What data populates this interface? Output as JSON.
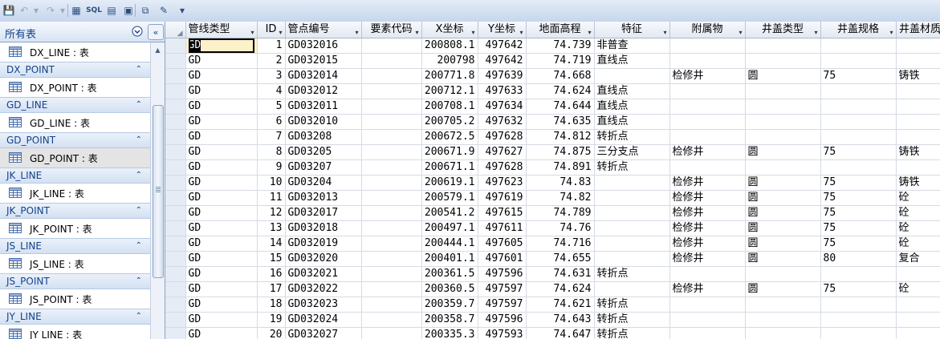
{
  "toolbar": {
    "buttons": [
      {
        "name": "save-icon",
        "glyph": "💾"
      },
      {
        "name": "undo-icon",
        "glyph": "↶"
      },
      {
        "name": "undo-dropdown-icon",
        "glyph": "▾"
      },
      {
        "name": "redo-icon",
        "glyph": "↷"
      },
      {
        "name": "redo-dropdown-icon",
        "glyph": "▾"
      },
      {
        "name": "form-wizard-icon",
        "glyph": "▦"
      },
      {
        "name": "sql-icon",
        "glyph": "SQL"
      },
      {
        "name": "report-icon",
        "glyph": "▤"
      },
      {
        "name": "query-icon",
        "glyph": "▣"
      },
      {
        "name": "toggle-view-icon",
        "glyph": "⧉"
      },
      {
        "name": "tools-icon",
        "glyph": "✎"
      },
      {
        "name": "customize-dropdown-icon",
        "glyph": "▾"
      }
    ]
  },
  "nav": {
    "title": "所有表",
    "menu_glyph": "⊙",
    "collapse_glyph": "«",
    "groups": [
      {
        "title": null,
        "items": [
          "DX_LINE : 表"
        ]
      },
      {
        "title": "DX_POINT",
        "items": [
          "DX_POINT : 表"
        ]
      },
      {
        "title": "GD_LINE",
        "items": [
          "GD_LINE : 表"
        ]
      },
      {
        "title": "GD_POINT",
        "items": [
          "GD_POINT : 表"
        ],
        "selected": true
      },
      {
        "title": "JK_LINE",
        "items": [
          "JK_LINE : 表"
        ]
      },
      {
        "title": "JK_POINT",
        "items": [
          "JK_POINT : 表"
        ]
      },
      {
        "title": "JS_LINE",
        "items": [
          "JS_LINE : 表"
        ]
      },
      {
        "title": "JS_POINT",
        "items": [
          "JS_POINT : 表"
        ]
      },
      {
        "title": "JY_LINE",
        "items": [
          "JY LINE : 表"
        ]
      }
    ],
    "chevron_glyph": "⌃"
  },
  "datasheet": {
    "columns": [
      "管线类型",
      "ID",
      "管点编号",
      "要素代码",
      "X坐标",
      "Y坐标",
      "地面高程",
      "特征",
      "附属物",
      "井盖类型",
      "井盖规格",
      "井盖材质"
    ],
    "rows": [
      [
        "GD",
        "1",
        "GD032016",
        "",
        "200808.1",
        "497642",
        "74.739",
        "非普查",
        "",
        "",
        "",
        ""
      ],
      [
        "GD",
        "2",
        "GD032015",
        "",
        "200798",
        "497642",
        "74.719",
        "直线点",
        "",
        "",
        "",
        ""
      ],
      [
        "GD",
        "3",
        "GD032014",
        "",
        "200771.8",
        "497639",
        "74.668",
        "",
        "检修井",
        "圆",
        "75",
        "铸铁"
      ],
      [
        "GD",
        "4",
        "GD032012",
        "",
        "200712.1",
        "497633",
        "74.624",
        "直线点",
        "",
        "",
        "",
        ""
      ],
      [
        "GD",
        "5",
        "GD032011",
        "",
        "200708.1",
        "497634",
        "74.644",
        "直线点",
        "",
        "",
        "",
        ""
      ],
      [
        "GD",
        "6",
        "GD032010",
        "",
        "200705.2",
        "497632",
        "74.635",
        "直线点",
        "",
        "",
        "",
        ""
      ],
      [
        "GD",
        "7",
        "GD03208",
        "",
        "200672.5",
        "497628",
        "74.812",
        "转折点",
        "",
        "",
        "",
        ""
      ],
      [
        "GD",
        "8",
        "GD03205",
        "",
        "200671.9",
        "497627",
        "74.875",
        "三分支点",
        "检修井",
        "圆",
        "75",
        "铸铁"
      ],
      [
        "GD",
        "9",
        "GD03207",
        "",
        "200671.1",
        "497628",
        "74.891",
        "转折点",
        "",
        "",
        "",
        ""
      ],
      [
        "GD",
        "10",
        "GD03204",
        "",
        "200619.1",
        "497623",
        "74.83",
        "",
        "检修井",
        "圆",
        "75",
        "铸铁"
      ],
      [
        "GD",
        "11",
        "GD032013",
        "",
        "200579.1",
        "497619",
        "74.82",
        "",
        "检修井",
        "圆",
        "75",
        "砼"
      ],
      [
        "GD",
        "12",
        "GD032017",
        "",
        "200541.2",
        "497615",
        "74.789",
        "",
        "检修井",
        "圆",
        "75",
        "砼"
      ],
      [
        "GD",
        "13",
        "GD032018",
        "",
        "200497.1",
        "497611",
        "74.76",
        "",
        "检修井",
        "圆",
        "75",
        "砼"
      ],
      [
        "GD",
        "14",
        "GD032019",
        "",
        "200444.1",
        "497605",
        "74.716",
        "",
        "检修井",
        "圆",
        "75",
        "砼"
      ],
      [
        "GD",
        "15",
        "GD032020",
        "",
        "200401.1",
        "497601",
        "74.655",
        "",
        "检修井",
        "圆",
        "80",
        "复合"
      ],
      [
        "GD",
        "16",
        "GD032021",
        "",
        "200361.5",
        "497596",
        "74.631",
        "转折点",
        "",
        "",
        "",
        ""
      ],
      [
        "GD",
        "17",
        "GD032022",
        "",
        "200360.5",
        "497597",
        "74.624",
        "",
        "检修井",
        "圆",
        "75",
        "砼"
      ],
      [
        "GD",
        "18",
        "GD032023",
        "",
        "200359.7",
        "497597",
        "74.621",
        "转折点",
        "",
        "",
        "",
        ""
      ],
      [
        "GD",
        "19",
        "GD032024",
        "",
        "200358.7",
        "497596",
        "74.643",
        "转折点",
        "",
        "",
        "",
        ""
      ],
      [
        "GD",
        "20",
        "GD032027",
        "",
        "200335.3",
        "497593",
        "74.647",
        "转折点",
        "",
        "",
        "",
        ""
      ]
    ],
    "sort_glyph": "▾",
    "selector_glyph": "◢"
  }
}
